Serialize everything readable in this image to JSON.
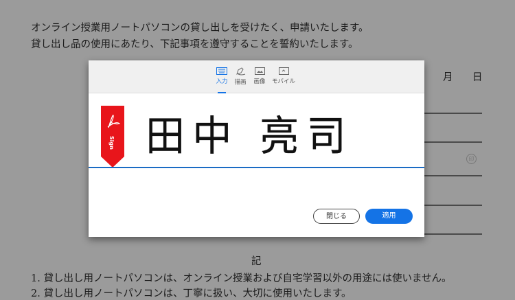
{
  "document": {
    "intro_lines": [
      "オンライン授業用ノートパソコンの貸し出しを受けたく、申請いたします。",
      "貸し出し品の使用にあたり、下記事項を遵守することを誓約いたします。"
    ],
    "month_label": "月",
    "day_label": "日",
    "seal_label": "印",
    "ki_heading": "記",
    "items": [
      "1. 貸し出し用ノートパソコンは、オンライン授業および自宅学習以外の用途には使いません。",
      "2. 貸し出し用ノートパソコンは、丁寧に扱い、大切に使用いたします。"
    ]
  },
  "dialog": {
    "tabs": [
      {
        "label": "入力",
        "icon": "keyboard-icon",
        "active": true
      },
      {
        "label": "描画",
        "icon": "pen-draw-icon",
        "active": false
      },
      {
        "label": "画像",
        "icon": "image-icon",
        "active": false
      },
      {
        "label": "モバイル",
        "icon": "mobile-icon",
        "active": false
      }
    ],
    "signature_text": "田中 亮司",
    "sign_tag_label": "Sign",
    "close_label": "閉じる",
    "apply_label": "適用",
    "accent_color": "#1473e6",
    "tag_color": "#e8151b"
  }
}
